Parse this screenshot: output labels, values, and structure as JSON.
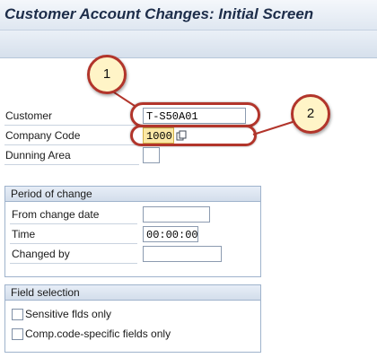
{
  "window": {
    "title": "Customer Account Changes: Initial Screen"
  },
  "form": {
    "customer_label": "Customer",
    "customer_value": "T-S50A01",
    "company_code_label": "Company Code",
    "company_code_value": "1000",
    "dunning_area_label": "Dunning Area",
    "dunning_area_value": ""
  },
  "period": {
    "title": "Period of change",
    "from_date_label": "From change date",
    "from_date_value": "",
    "time_label": "Time",
    "time_value": "00:00:00",
    "changed_by_label": "Changed by",
    "changed_by_value": ""
  },
  "field_selection": {
    "title": "Field selection",
    "sensitive_label": "Sensitive flds only",
    "sensitive_checked": false,
    "company_specific_label": "Comp.code-specific fields only",
    "company_specific_checked": false
  },
  "annotations": [
    {
      "number": "1"
    },
    {
      "number": "2"
    }
  ],
  "colors": {
    "highlight": "#b2352b",
    "required_field": "#fbe8a6"
  }
}
